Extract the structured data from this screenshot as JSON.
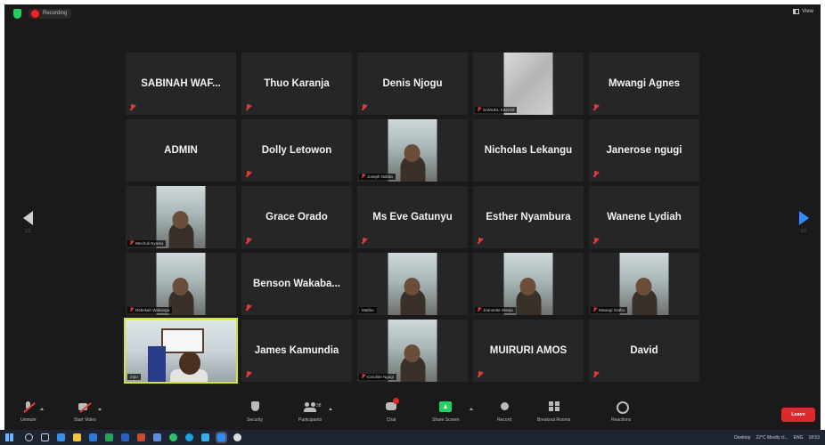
{
  "topbar": {
    "recording_label": "Recording",
    "view_label": "View"
  },
  "pagination": {
    "left_page": "1/2",
    "right_page": "2/2"
  },
  "participants": [
    {
      "name": "SABINAH WAF...",
      "kind": "name",
      "muted": true
    },
    {
      "name": "Thuo Karanja",
      "kind": "name",
      "muted": true
    },
    {
      "name": "Denis Njogu",
      "kind": "name",
      "muted": true
    },
    {
      "name": "SAMUEL KIMANI",
      "kind": "video-gray",
      "muted": true
    },
    {
      "name": "Mwangi Agnes",
      "kind": "name",
      "muted": true
    },
    {
      "name": "ADMIN",
      "kind": "name",
      "muted": false
    },
    {
      "name": "Dolly Letowon",
      "kind": "name",
      "muted": true
    },
    {
      "name": "Joseph Ndirita",
      "kind": "video",
      "muted": true
    },
    {
      "name": "Nicholas Lekangu",
      "kind": "name",
      "muted": false
    },
    {
      "name": "Janerose ngugi",
      "kind": "name",
      "muted": true
    },
    {
      "name": "Wechuli Nyarko",
      "kind": "video",
      "muted": true
    },
    {
      "name": "Grace Orado",
      "kind": "name",
      "muted": true
    },
    {
      "name": "Ms Eve Gatunyu",
      "kind": "name",
      "muted": true
    },
    {
      "name": "Esther Nyambura",
      "kind": "name",
      "muted": true
    },
    {
      "name": "Wanene Lydiah",
      "kind": "name",
      "muted": true
    },
    {
      "name": "Rebekah Wakanga",
      "kind": "video",
      "muted": true
    },
    {
      "name": "Benson  Wakaba...",
      "kind": "name",
      "muted": true
    },
    {
      "name": "Matibu",
      "kind": "video",
      "muted": false
    },
    {
      "name": "Jeannette Wanja",
      "kind": "video",
      "muted": true
    },
    {
      "name": "Mwangi Gathu",
      "kind": "video",
      "muted": true
    },
    {
      "name": "Zipo",
      "kind": "self",
      "muted": false
    },
    {
      "name": "James Kamundia",
      "kind": "name",
      "muted": true
    },
    {
      "name": "Caroline Ngugi",
      "kind": "video",
      "muted": true
    },
    {
      "name": "MUIRURI AMOS",
      "kind": "name",
      "muted": true
    },
    {
      "name": "David",
      "kind": "name",
      "muted": true
    }
  ],
  "toolbar": {
    "unmute": "Unmute",
    "start_video": "Start Video",
    "security": "Security",
    "participants": "Participants",
    "participants_count": "38",
    "chat": "Chat",
    "share_screen": "Share Screen",
    "record": "Record",
    "breakout_rooms": "Breakout Rooms",
    "reactions": "Reactions",
    "leave": "Leave"
  },
  "taskbar": {
    "desktop_label": "Desktop",
    "weather": "22°C  Mostly cl...",
    "language": "ENG",
    "time": "18:53"
  },
  "colors": {
    "accent_blue": "#2d8cff",
    "leave_red": "#e0282c",
    "share_green": "#23d160",
    "active_speaker": "#d4e23a"
  }
}
